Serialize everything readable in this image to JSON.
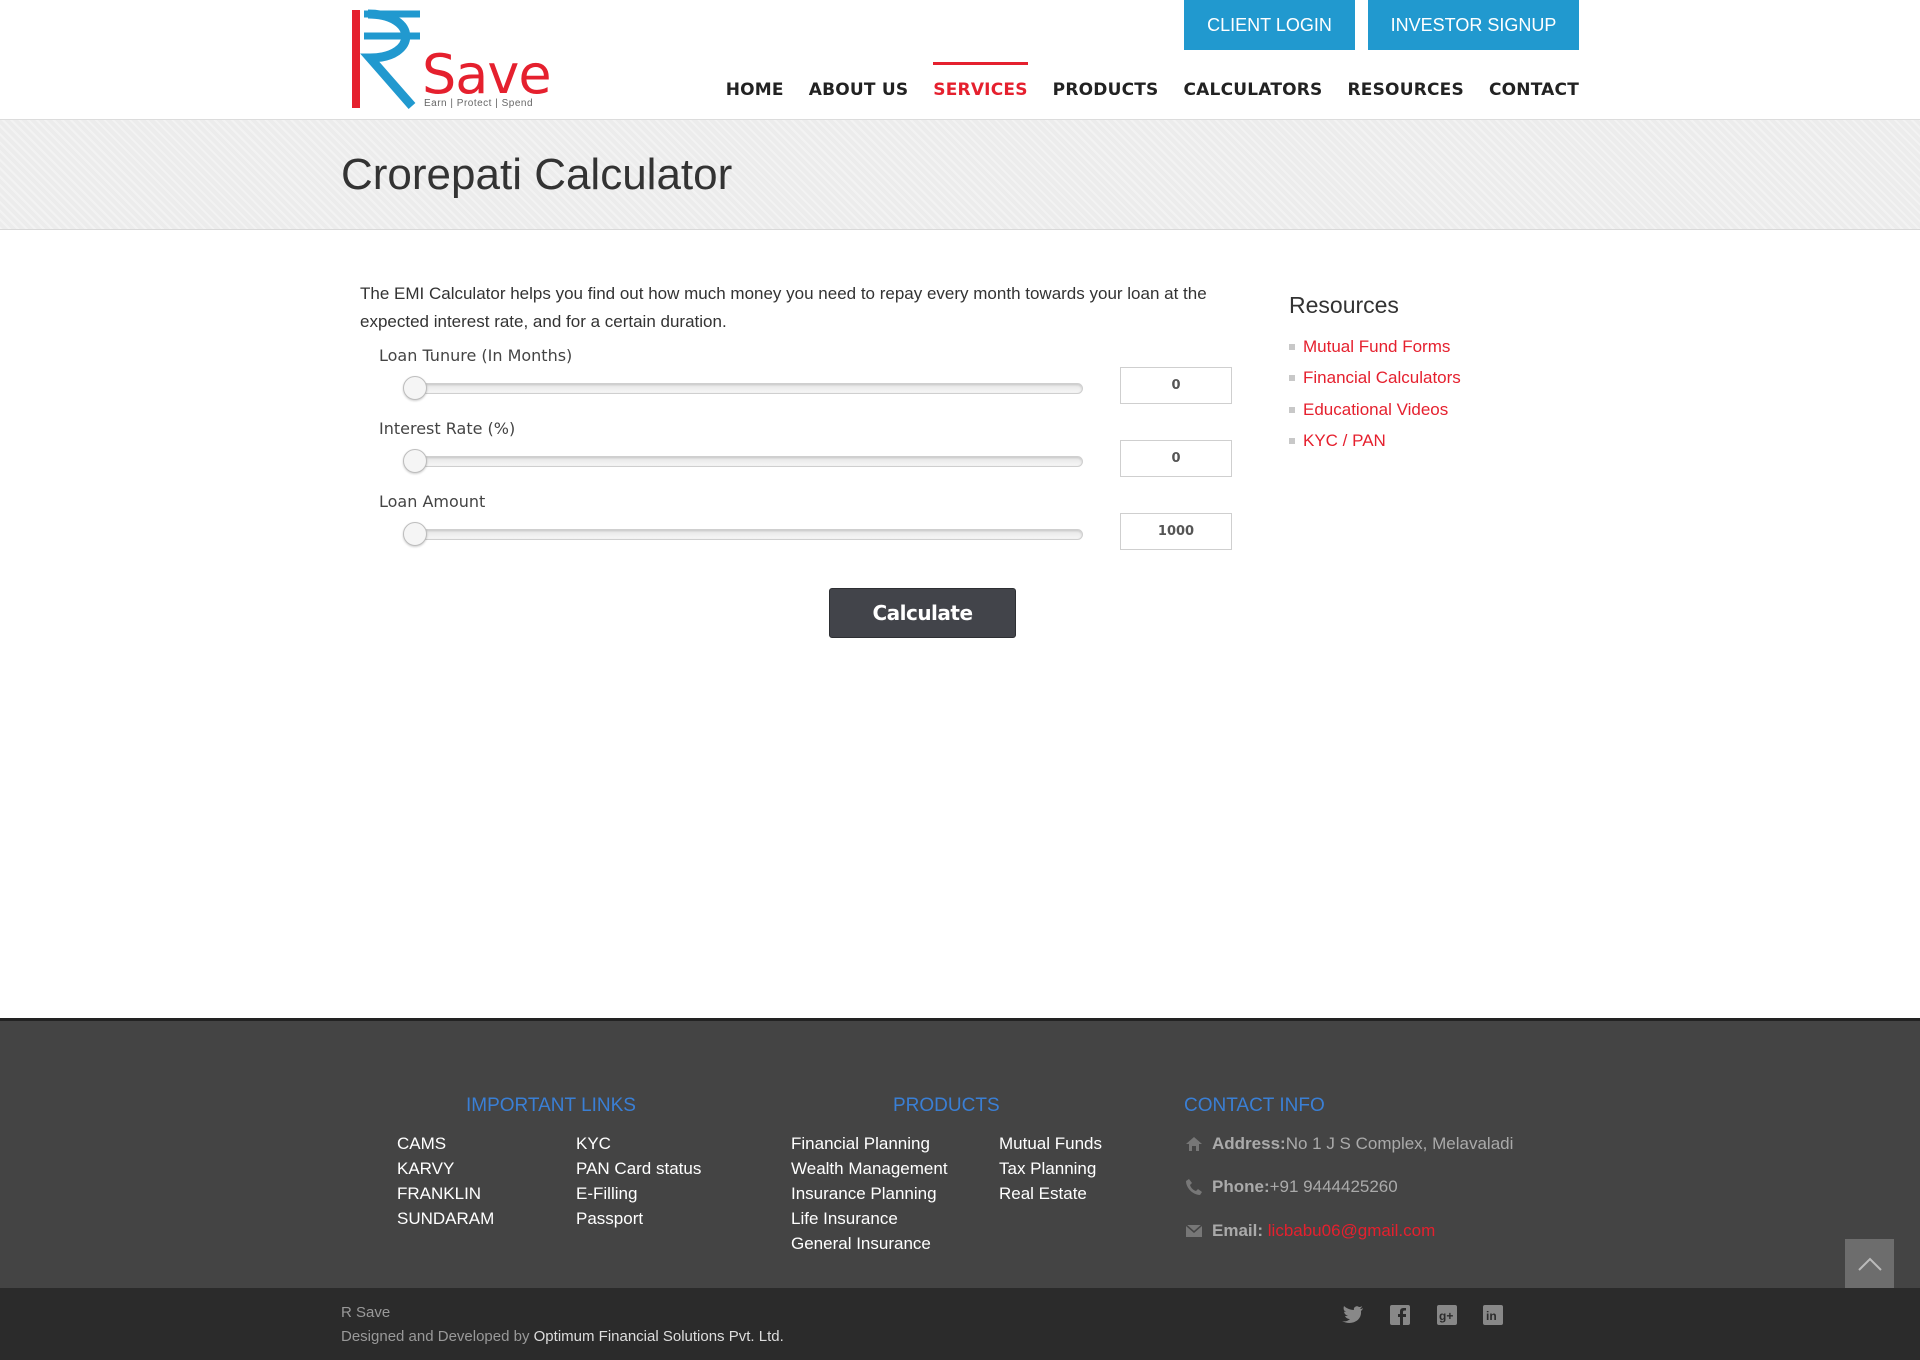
{
  "header": {
    "logo": {
      "brand": "Save",
      "tagline": "Earn | Protect | Spend"
    },
    "buttons": {
      "client_login": "CLIENT LOGIN",
      "investor_signup": "INVESTOR SIGNUP"
    },
    "nav": [
      "HOME",
      "ABOUT US",
      "SERVICES",
      "PRODUCTS",
      "CALCULATORS",
      "RESOURCES",
      "CONTACT"
    ],
    "active_nav": "SERVICES"
  },
  "page": {
    "title": "Crorepati Calculator",
    "intro": "The EMI Calculator helps you find out how much money you need to repay every month towards your loan at the expected interest rate, and for a certain duration."
  },
  "calculator": {
    "fields": [
      {
        "label": "Loan Tunure (In Months)",
        "value": "0"
      },
      {
        "label": "Interest Rate (%)",
        "value": "0"
      },
      {
        "label": "Loan Amount",
        "value": "1000"
      }
    ],
    "button": "Calculate"
  },
  "sidebar": {
    "title": "Resources",
    "links": [
      "Mutual Fund Forms",
      "Financial Calculators",
      "Educational Videos",
      "KYC / PAN"
    ]
  },
  "footer": {
    "important_links": {
      "title": "IMPORTANT LINKS",
      "col1": [
        "CAMS",
        "KARVY",
        "FRANKLIN",
        "SUNDARAM"
      ],
      "col2": [
        "KYC",
        "PAN Card status",
        "E-Filling",
        "Passport"
      ]
    },
    "products": {
      "title": "PRODUCTS",
      "col1": [
        "Financial Planning",
        "Wealth Management",
        "Insurance Planning",
        "Life Insurance",
        "General Insurance"
      ],
      "col2": [
        "Mutual Funds",
        "Tax Planning",
        "Real Estate"
      ]
    },
    "contact": {
      "title": "CONTACT INFO",
      "address_label": "Address:",
      "address": "No 1 J S Complex, Melavaladi",
      "phone_label": "Phone:",
      "phone": "+91 9444425260",
      "email_label": "Email:",
      "email": "licbabu06@gmail.com"
    },
    "copyright": "R Save",
    "designed_by_prefix": "Designed and Developed by ",
    "designed_by": "Optimum Financial Solutions Pvt. Ltd."
  },
  "icons": [
    "home-icon",
    "phone-icon",
    "mail-icon",
    "twitter-icon",
    "facebook-icon",
    "google-plus-icon",
    "linkedin-icon",
    "chevron-up-icon"
  ],
  "colors": {
    "accent_red": "#e5202e",
    "accent_blue": "#2199cf",
    "footer_heading": "#3a7fd5",
    "footer_bg": "#444444"
  }
}
